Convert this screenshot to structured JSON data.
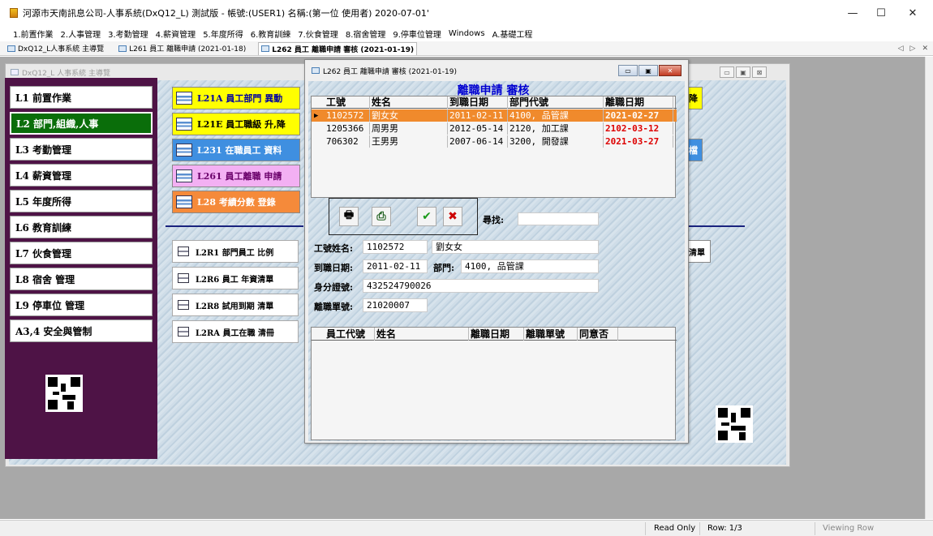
{
  "window": {
    "title": "河源市天南訊息公司-人事系統(DxQ12_L) 測試版 - 帳號:(USER1) 名稱:(第一位 使用者) 2020-07-01'",
    "minimize": "—",
    "maximize": "☐",
    "close": "✕"
  },
  "menu": [
    "1.前置作業",
    "2.人事管理",
    "3.考勤管理",
    "4.薪資管理",
    "5.年度所得",
    "6.教育訓練",
    "7.伙食管理",
    "8.宿舍管理",
    "9.停車位管理",
    "Windows",
    "A.基礎工程"
  ],
  "tabs": [
    {
      "label": "DxQ12_L人事系統 主導覽"
    },
    {
      "label": "L261 員工 離職申請 (2021-01-18)"
    },
    {
      "label": "L262 員工 離職申請 審核 (2021-01-19)"
    }
  ],
  "tab_arrows": {
    "left": "◁",
    "right": "▷",
    "close": "✕"
  },
  "main_window": {
    "title": "DxQ12_L 人事系統 主導覽",
    "nav": [
      "L1 前置作業",
      "L2 部門,組織,人事",
      "L3 考勤管理",
      "L4 薪資管理",
      "L5 年度所得",
      "L6 教育訓練",
      "L7 伙食管理",
      "L8 宿舍 管理",
      "L9 停車位 管理",
      "A3,4 安全與管制"
    ],
    "func_buttons": [
      {
        "label": "L21A 員工部門 異動",
        "bg": "#ffff00",
        "fg": "#0000a0"
      },
      {
        "label": "L21E 員工職級 升,降",
        "bg": "#ffff00",
        "fg": "#000000"
      },
      {
        "label": "L231 在職員工 資料",
        "bg": "#3f8fe0",
        "fg": "#ffffff"
      },
      {
        "label": "L261 員工離職 申請",
        "bg": "#f3b0f3",
        "fg": "#6a006a"
      },
      {
        "label": "L28 考績分數 登錄",
        "bg": "#f58a3a",
        "fg": "#ffffff"
      }
    ],
    "report_buttons": [
      "L2R1 部門員工 比例",
      "L2R6 員工 年資清單",
      "L2R8 試用到期 清單",
      "L2RA 員工在職 清冊"
    ],
    "right_partial": {
      "yellow_tail": "降",
      "blue_tail": "檔",
      "white_tail": "清單"
    }
  },
  "dialog": {
    "title": "L262 員工 離職申請 審核 (2021-01-19)",
    "heading": "離職申請 審核",
    "grid_columns": [
      "工號",
      "姓名",
      "到職日期",
      "部門代號",
      "離職日期"
    ],
    "grid_rows": [
      [
        "1102572",
        "劉女女",
        "2011-02-11",
        "4100, 品管課",
        "2021-02-27"
      ],
      [
        "1205366",
        "周男男",
        "2012-05-14",
        "2120, 加工課",
        "2102-03-12"
      ],
      [
        "706302",
        "王男男",
        "2007-06-14",
        "3200, 開發課",
        "2021-03-27"
      ]
    ],
    "selected_row_marker": "▶",
    "toolbar": {
      "print": "🖶",
      "export": "⎙",
      "approve": "✔",
      "reject": "✖"
    },
    "search_label": "尋找:",
    "search_value": "",
    "fields": {
      "emp_label": "工號姓名:",
      "emp_id": "1102572",
      "emp_name": "劉女女",
      "hire_label": "到職日期:",
      "hire_date": "2011-02-11",
      "dept_label": "部門:",
      "dept": "4100, 品管課",
      "id_label": "身分證號:",
      "id_no": "432524790026",
      "form_label": "離職單號:",
      "form_no": "21020007"
    },
    "grid2_columns": [
      "員工代號",
      "姓名",
      "離職日期",
      "離職單號",
      "同意否"
    ]
  },
  "statusbar": {
    "read_only": "Read Only",
    "row": "Row: 1/3",
    "mode": "Viewing Row"
  }
}
